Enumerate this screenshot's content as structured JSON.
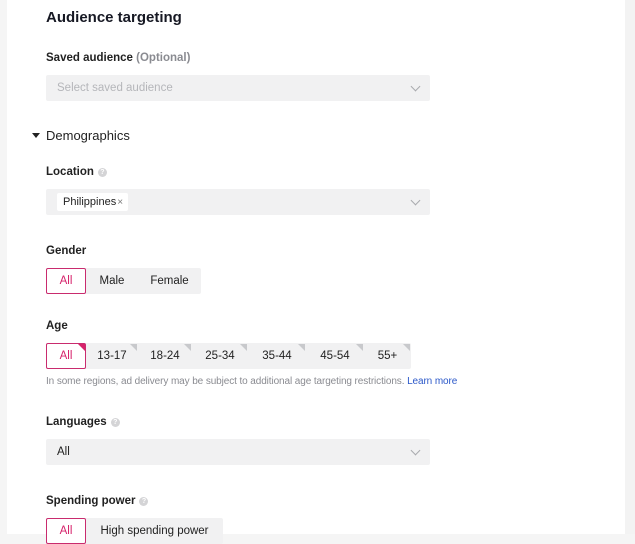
{
  "section": {
    "title": "Audience targeting"
  },
  "saved_audience": {
    "label": "Saved audience",
    "optional": "(Optional)",
    "placeholder": "Select saved audience"
  },
  "demographics": {
    "label": "Demographics",
    "expanded": true
  },
  "location": {
    "label": "Location",
    "tags": [
      {
        "label": "Philippines",
        "remove": "×"
      }
    ]
  },
  "gender": {
    "label": "Gender",
    "options": [
      "All",
      "Male",
      "Female"
    ],
    "selected": "All"
  },
  "age": {
    "label": "Age",
    "options": [
      "All",
      "13-17",
      "18-24",
      "25-34",
      "35-44",
      "45-54",
      "55+"
    ],
    "selected": "All",
    "hint": "In some regions, ad delivery may be subject to additional age targeting restrictions.",
    "learn_more": "Learn more"
  },
  "languages": {
    "label": "Languages",
    "value": "All"
  },
  "spending_power": {
    "label": "Spending power",
    "options": [
      "All",
      "High spending power"
    ],
    "selected": "All"
  },
  "colors": {
    "accent": "#d6226a",
    "link": "#2b58c9",
    "field_bg": "#f1f1f2"
  }
}
